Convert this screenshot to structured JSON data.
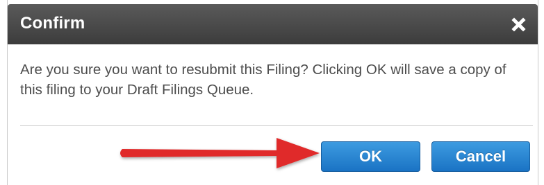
{
  "dialog": {
    "title": "Confirm",
    "close_icon": "close-x-icon",
    "message": "Are you sure you want to resubmit this Filing? Clicking OK will save a copy of this filing to your Draft Filings Queue.",
    "buttons": {
      "ok_label": "OK",
      "cancel_label": "Cancel"
    }
  },
  "annotation": {
    "arrow_icon": "red-arrow-icon",
    "arrow_color": "#e02b2b"
  },
  "colors": {
    "titlebar": "#4a4a4a",
    "button": "#2a86d6",
    "message_text": "#4d4d4d"
  }
}
